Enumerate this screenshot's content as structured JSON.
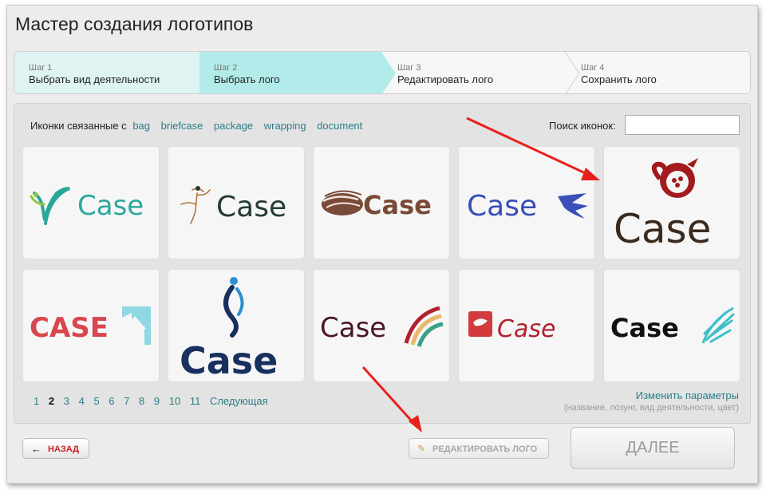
{
  "window": {
    "title": "Мастер создания логотипов"
  },
  "steps": [
    {
      "num": "Шаг 1",
      "label": "Выбрать вид деятельности"
    },
    {
      "num": "Шаг 2",
      "label": "Выбрать лого"
    },
    {
      "num": "Шаг 3",
      "label": "Редактировать лого"
    },
    {
      "num": "Шаг 4",
      "label": "Сохранить лого"
    }
  ],
  "related": {
    "label": "Иконки связанные с",
    "tags": [
      "bag",
      "briefcase",
      "package",
      "wrapping",
      "document"
    ]
  },
  "search": {
    "label": "Поиск иконок:",
    "value": ""
  },
  "logos": [
    {
      "text": "Case",
      "color": "#2aa79b",
      "icon": "leaf-figure-icon"
    },
    {
      "text": "Case",
      "color": "#253b33",
      "icon": "dancer-icon"
    },
    {
      "text": "Case",
      "color": "#7a4a38",
      "icon": "swirl-disc-icon"
    },
    {
      "text": "Case",
      "color": "#3a4fb8",
      "icon": "wing-icon"
    },
    {
      "text": "Case",
      "color": "#3a2a1e",
      "icon": "pomegranate-icon"
    },
    {
      "text": "CASE",
      "color": "#d8474f",
      "icon": "house-icon"
    },
    {
      "text": "Case",
      "color": "#17305e",
      "icon": "person-swoosh-icon"
    },
    {
      "text": "Case",
      "color": "#4a1622",
      "icon": "rainbow-arc-icon"
    },
    {
      "text": "Case",
      "color": "#b0202e",
      "icon": "red-stamp-icon"
    },
    {
      "text": "Case",
      "color": "#111111",
      "icon": "feather-icon"
    }
  ],
  "pager": {
    "pages": [
      "1",
      "2",
      "3",
      "4",
      "5",
      "6",
      "7",
      "8",
      "9",
      "10",
      "11"
    ],
    "current": "2",
    "next": "Следующая"
  },
  "change": {
    "label": "Изменить параметры",
    "hint": "(название, лозунг, вид деятельности, цвет)"
  },
  "buttons": {
    "back": "НАЗАД",
    "edit": "РЕДАКТИРОВАТЬ ЛОГО",
    "next": "ДАЛЕЕ"
  },
  "colors": {
    "accent": "#2a7d88",
    "active_step": "#b2ecea",
    "done_step": "#dff3f3",
    "arrow": "#e8201c"
  }
}
